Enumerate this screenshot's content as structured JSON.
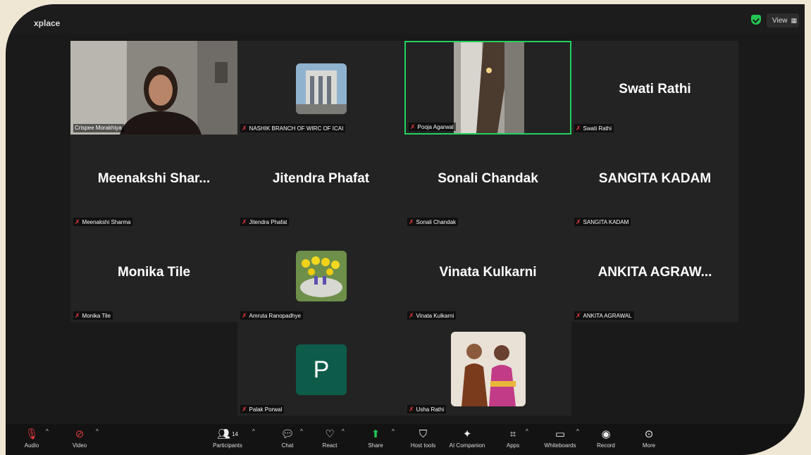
{
  "app": {
    "title": "xplace",
    "view_label": "View"
  },
  "participants_tiles": [
    {
      "name": "Crispee Morakhiya",
      "type": "video",
      "muted": false
    },
    {
      "name": "NASHIK BRANCH OF WIRC OF ICAI",
      "type": "image",
      "muted": true
    },
    {
      "name": "Pooja Agarwal",
      "type": "video",
      "muted": true,
      "active_speaker": true
    },
    {
      "name": "Swati Rathi",
      "type": "name",
      "display": "Swati Rathi",
      "muted": true
    },
    {
      "name": "Meenakshi Sharma",
      "type": "name",
      "display": "Meenakshi  Shar...",
      "muted": true
    },
    {
      "name": "Jitendra Phafat",
      "type": "name",
      "display": "Jitendra Phafat",
      "muted": true
    },
    {
      "name": "Sonali Chandak",
      "type": "name",
      "display": "Sonali Chandak",
      "muted": true
    },
    {
      "name": "SANGITA KADAM",
      "type": "name",
      "display": "SANGITA KADAM",
      "muted": true
    },
    {
      "name": "Monika Tile",
      "type": "name",
      "display": "Monika Tile",
      "muted": true
    },
    {
      "name": "Amruta Ranopadhye",
      "type": "image",
      "muted": true
    },
    {
      "name": "Vinata Kulkarni",
      "type": "name",
      "display": "Vinata Kulkarni",
      "muted": true
    },
    {
      "name": "ANKITA AGRAWAL",
      "type": "name",
      "display": "ANKITA  AGRAW...",
      "muted": true
    },
    {
      "name": "Palak Porwal",
      "type": "initial",
      "initial": "P",
      "muted": true
    },
    {
      "name": "Usha Rathi",
      "type": "image",
      "muted": true
    }
  ],
  "toolbar": {
    "audio": "Audio",
    "video": "Video",
    "participants": "Participants",
    "participants_count": "14",
    "chat": "Chat",
    "react": "React",
    "share": "Share",
    "host_tools": "Host tools",
    "ai_companion": "AI Companion",
    "apps": "Apps",
    "whiteboards": "Whiteboards",
    "record": "Record",
    "more": "More"
  },
  "colors": {
    "active_border": "#23d160",
    "muted_mic": "#e0393e",
    "tile_bg": "#232323",
    "initial_bg": "#0d5c4a"
  }
}
